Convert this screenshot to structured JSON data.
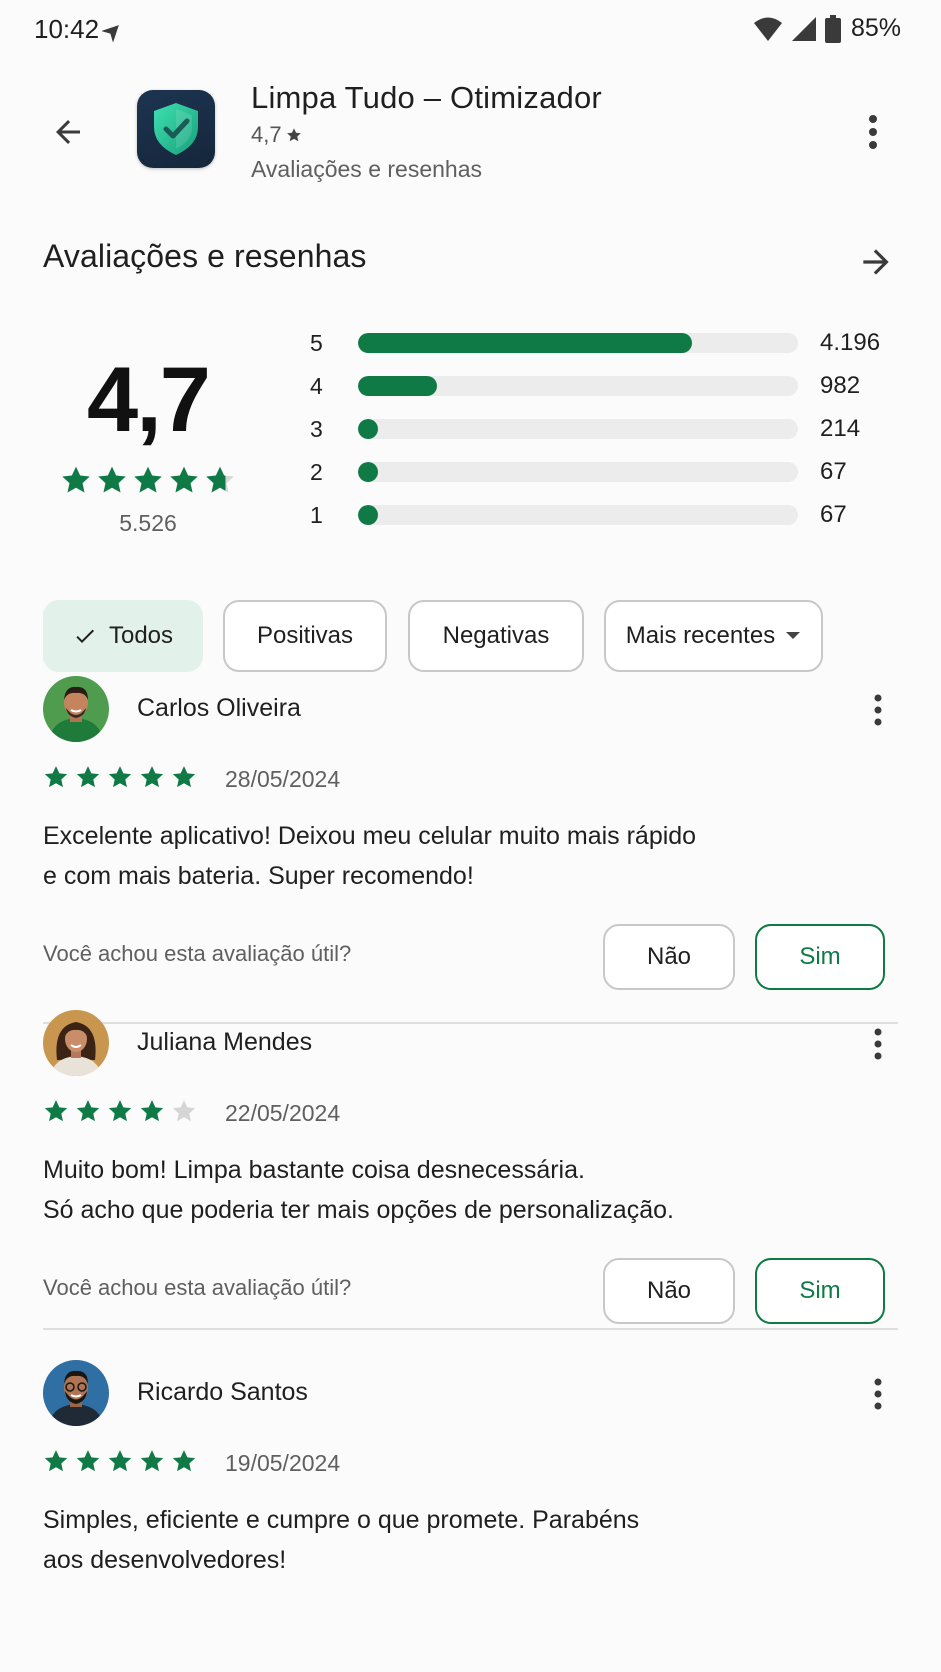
{
  "status_bar": {
    "time": "10:42",
    "battery": "85%"
  },
  "app": {
    "title": "Limpa Tudo – Otimizador",
    "rating": "4,7",
    "subtitle": "Avaliações e resenhas"
  },
  "section": {
    "title": "Avaliações e resenhas"
  },
  "summary": {
    "rating": "4,7",
    "stars": 4.7,
    "count": "5.526"
  },
  "histogram": [
    {
      "label": "5",
      "count": "4.196",
      "fraction": 0.76
    },
    {
      "label": "4",
      "count": "982",
      "fraction": 0.18
    },
    {
      "label": "3",
      "count": "214",
      "fraction": 0.04
    },
    {
      "label": "2",
      "count": "67",
      "fraction": 0.012
    },
    {
      "label": "1",
      "count": "67",
      "fraction": 0.012
    }
  ],
  "filters": {
    "all": "Todos",
    "positive": "Positivas",
    "negative": "Negativas",
    "sort": "Mais recentes"
  },
  "reviews": [
    {
      "name": "Carlos Oliveira",
      "stars": 5,
      "date": "28/05/2024",
      "line1": "Excelente aplicativo! Deixou meu celular muito mais rápido",
      "line2": "e com mais bateria. Super recomendo!",
      "helpful_question": "Você achou esta avaliação útil?",
      "no": "Não",
      "yes": "Sim"
    },
    {
      "name": "Juliana Mendes",
      "stars": 4,
      "date": "22/05/2024",
      "line1": "Muito bom! Limpa bastante coisa desnecessária.",
      "line2": "Só acho que poderia ter mais opções de personalização.",
      "helpful_question": "Você achou esta avaliação útil?",
      "no": "Não",
      "yes": "Sim"
    },
    {
      "name": "Ricardo Santos",
      "stars": 5,
      "date": "19/05/2024",
      "line1": "Simples, eficiente e cumpre o que promete. Parabéns",
      "line2": "aos desenvolvedores!"
    }
  ],
  "colors": {
    "accent": "#0f7a45",
    "chip_selected": "#e2f1e9",
    "star_empty": "#d6d6d6"
  }
}
